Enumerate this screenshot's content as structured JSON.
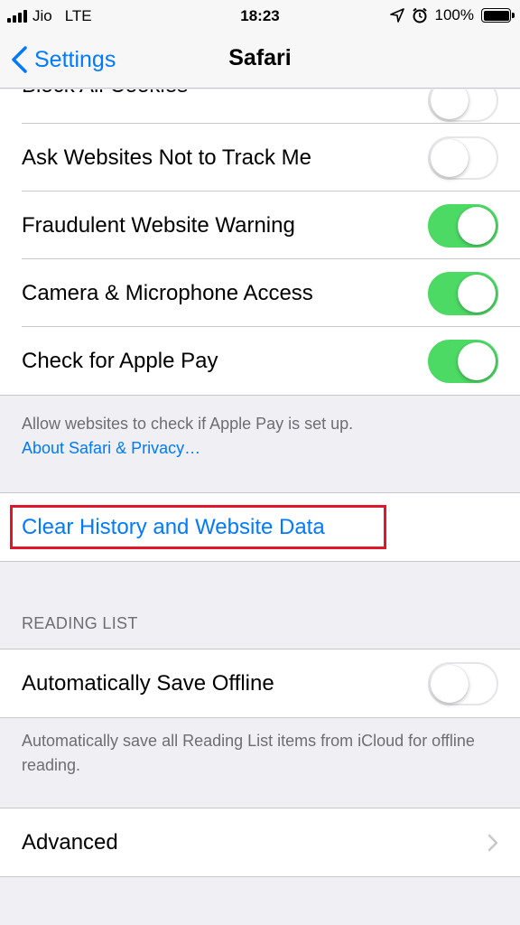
{
  "status_bar": {
    "carrier": "Jio",
    "network": "LTE",
    "time": "18:23",
    "battery_percent": "100%",
    "icons": [
      "signal-icon",
      "location-icon",
      "alarm-icon",
      "battery-icon"
    ]
  },
  "nav": {
    "back_label": "Settings",
    "title": "Safari"
  },
  "privacy": {
    "rows": [
      {
        "label": "Block All Cookies",
        "toggle": "off"
      },
      {
        "label": "Ask Websites Not to Track Me",
        "toggle": "off"
      },
      {
        "label": "Fraudulent Website Warning",
        "toggle": "on"
      },
      {
        "label": "Camera & Microphone Access",
        "toggle": "on"
      },
      {
        "label": "Check for Apple Pay",
        "toggle": "on"
      }
    ],
    "footer_text": "Allow websites to check if Apple Pay is set up.",
    "footer_link": "About Safari & Privacy…"
  },
  "clear_history": {
    "label": "Clear History and Website Data",
    "highlight_color": "#e0162b"
  },
  "reading_list": {
    "header": "READING LIST",
    "row": {
      "label": "Automatically Save Offline",
      "toggle": "off"
    },
    "footer": "Automatically save all Reading List items from iCloud for offline reading."
  },
  "advanced": {
    "label": "Advanced"
  },
  "colors": {
    "accent": "#007aff",
    "toggle_on": "#4cd964",
    "background": "#efeff4"
  }
}
